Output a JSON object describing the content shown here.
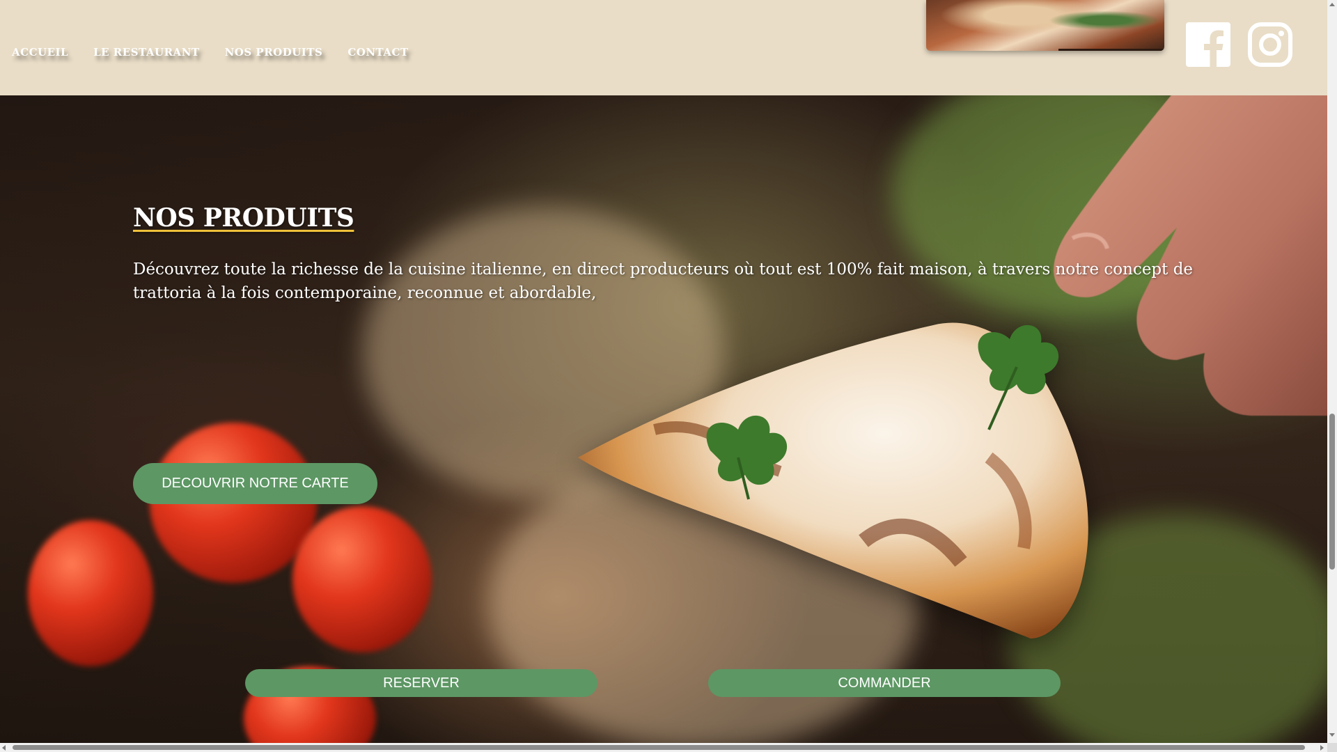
{
  "nav": {
    "items": [
      {
        "label": "ACCUEIL"
      },
      {
        "label": "LE RESTAURANT"
      },
      {
        "label": "NOS PRODUITS"
      },
      {
        "label": "CONTACT"
      }
    ]
  },
  "social": {
    "facebook_icon": "facebook-icon",
    "instagram_icon": "instagram-icon"
  },
  "hero": {
    "title": "NOS PRODUITS",
    "text": "Découvrez toute la richesse de la cuisine italienne, en direct producteurs où tout est 100% fait maison, à travers notre concept de trattoria à la fois contemporaine, reconnue et abordable,",
    "cta_label": "DECOUVRIR NOTRE CARTE"
  },
  "actions": {
    "reserver_label": "RESERVER",
    "commander_label": "COMMANDER"
  },
  "colors": {
    "header_bg": "#e9ddc7",
    "button_green": "#5d9764",
    "title_underline": "#f0c23a"
  }
}
